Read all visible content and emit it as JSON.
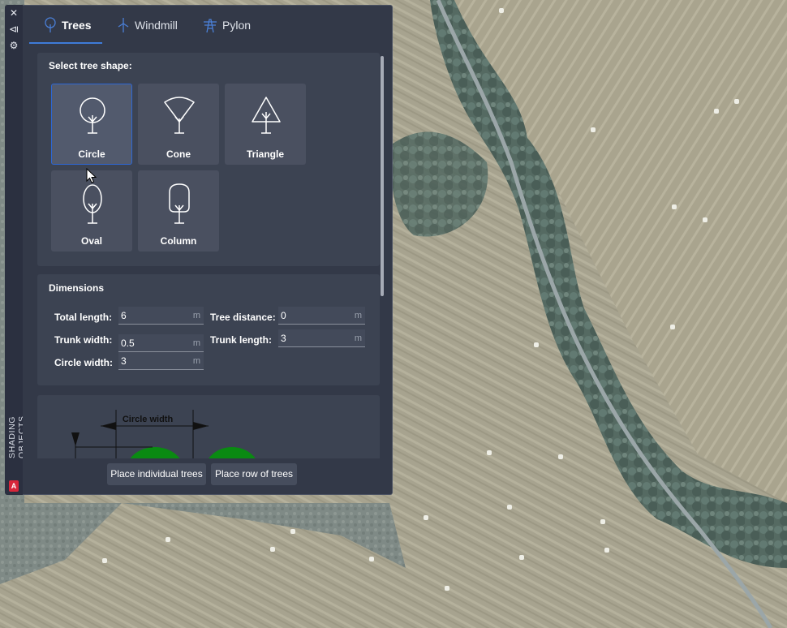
{
  "app": {
    "panel_title": "SHADING OBJECTS",
    "logo_letter": "A"
  },
  "strip": {
    "icons": [
      "close-icon",
      "collapse-icon",
      "settings-icon"
    ],
    "close_glyph": "✕",
    "collapse_glyph": "⧏",
    "settings_glyph": "⚙"
  },
  "tabs": [
    {
      "label": "Trees",
      "icon": "tree-icon",
      "active": true
    },
    {
      "label": "Windmill",
      "icon": "windmill-icon",
      "active": false
    },
    {
      "label": "Pylon",
      "icon": "pylon-icon",
      "active": false
    }
  ],
  "shape_section": {
    "title": "Select tree shape:",
    "shapes": [
      {
        "label": "Circle",
        "icon": "circle-tree-icon",
        "selected": true
      },
      {
        "label": "Cone",
        "icon": "cone-tree-icon",
        "selected": false
      },
      {
        "label": "Triangle",
        "icon": "triangle-tree-icon",
        "selected": false
      },
      {
        "label": "Oval",
        "icon": "oval-tree-icon",
        "selected": false
      },
      {
        "label": "Column",
        "icon": "column-tree-icon",
        "selected": false
      }
    ]
  },
  "dimensions": {
    "title": "Dimensions",
    "fields": {
      "total_length": {
        "label": "Total length:",
        "value": "6",
        "unit": "m"
      },
      "tree_distance": {
        "label": "Tree distance:",
        "value": "0",
        "unit": "m"
      },
      "trunk_width": {
        "label": "Trunk width:",
        "value": "0.5",
        "unit": "m"
      },
      "trunk_length": {
        "label": "Trunk length:",
        "value": "3",
        "unit": "m"
      },
      "circle_width": {
        "label": "Circle width:",
        "value": "3",
        "unit": "m"
      }
    }
  },
  "diagram": {
    "label": "Circle width",
    "tree_color": "#0a8a12"
  },
  "buttons": {
    "place_individual": "Place individual trees",
    "place_row": "Place row of trees"
  },
  "colors": {
    "panel_bg": "#333948",
    "section_bg": "#3c4352",
    "accent": "#3e7bd8"
  }
}
